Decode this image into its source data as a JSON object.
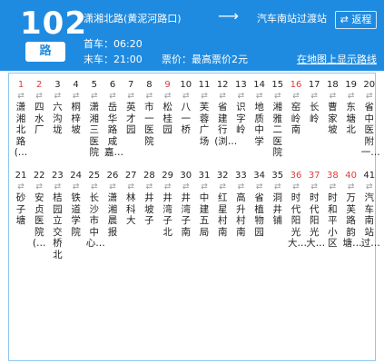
{
  "header": {
    "route_number": "102",
    "route_suffix": "路",
    "from": "潇湘北路(黄泥河路口)",
    "arrow": "⟶",
    "to": "汽车南站过渡站",
    "return_label": "⇄ 返程",
    "first_bus": "首车：06:20",
    "last_bus": "末车：21:00",
    "fare": "票价：最高票价2元",
    "map_link": "在地图上显示路线"
  },
  "colors": {
    "header_bg": "#1f8be0",
    "highlight": "#e23b3b"
  },
  "stops": [
    {
      "n": "1",
      "name": "潇湘北路(…",
      "red": true
    },
    {
      "n": "2",
      "name": "四水厂",
      "red": true
    },
    {
      "n": "3",
      "name": "六沟垅",
      "red": false
    },
    {
      "n": "4",
      "name": "桐梓坡",
      "red": false
    },
    {
      "n": "5",
      "name": "潇湘三医院",
      "red": false
    },
    {
      "n": "6",
      "name": "岳华路咸嘉…",
      "red": false
    },
    {
      "n": "7",
      "name": "英才园",
      "red": false
    },
    {
      "n": "8",
      "name": "市一医院",
      "red": false
    },
    {
      "n": "9",
      "name": "松桂园",
      "red": true
    },
    {
      "n": "10",
      "name": "八一桥",
      "red": false
    },
    {
      "n": "11",
      "name": "芙蓉广场",
      "red": false
    },
    {
      "n": "12",
      "name": "省建行(浏…",
      "red": false
    },
    {
      "n": "13",
      "name": "识字岭",
      "red": false
    },
    {
      "n": "14",
      "name": "地质中学",
      "red": false
    },
    {
      "n": "15",
      "name": "湘雅二医院",
      "red": false
    },
    {
      "n": "16",
      "name": "窑岭南",
      "red": true
    },
    {
      "n": "17",
      "name": "长岭",
      "red": false
    },
    {
      "n": "18",
      "name": "曹家坡",
      "red": false
    },
    {
      "n": "19",
      "name": "东塘北",
      "red": false
    },
    {
      "n": "20",
      "name": "省中医附一…",
      "red": false
    },
    {
      "n": "21",
      "name": "砂子塘",
      "red": false
    },
    {
      "n": "22",
      "name": "安贞医院(…",
      "red": false
    },
    {
      "n": "23",
      "name": "桔园立交桥北",
      "red": false
    },
    {
      "n": "24",
      "name": "铁道学院",
      "red": false
    },
    {
      "n": "25",
      "name": "长沙市中心…",
      "red": false
    },
    {
      "n": "26",
      "name": "潇湘晨报",
      "red": false
    },
    {
      "n": "27",
      "name": "林科大",
      "red": false
    },
    {
      "n": "28",
      "name": "井坡子",
      "red": false
    },
    {
      "n": "29",
      "name": "井湾子北",
      "red": false
    },
    {
      "n": "30",
      "name": "井湾子南",
      "red": false
    },
    {
      "n": "31",
      "name": "中建五局",
      "red": false
    },
    {
      "n": "32",
      "name": "红星村南",
      "red": false
    },
    {
      "n": "33",
      "name": "高升村南",
      "red": false
    },
    {
      "n": "34",
      "name": "省植物园",
      "red": false
    },
    {
      "n": "35",
      "name": "洞井铺",
      "red": false
    },
    {
      "n": "36",
      "name": "时代阳光大…",
      "red": true
    },
    {
      "n": "37",
      "name": "时代阳光大…",
      "red": true
    },
    {
      "n": "38",
      "name": "时和平小区",
      "red": true
    },
    {
      "n": "40",
      "name": "万芙路韵塘…",
      "red": true
    },
    {
      "n": "41",
      "name": "汽车南站过…",
      "red": false
    }
  ]
}
